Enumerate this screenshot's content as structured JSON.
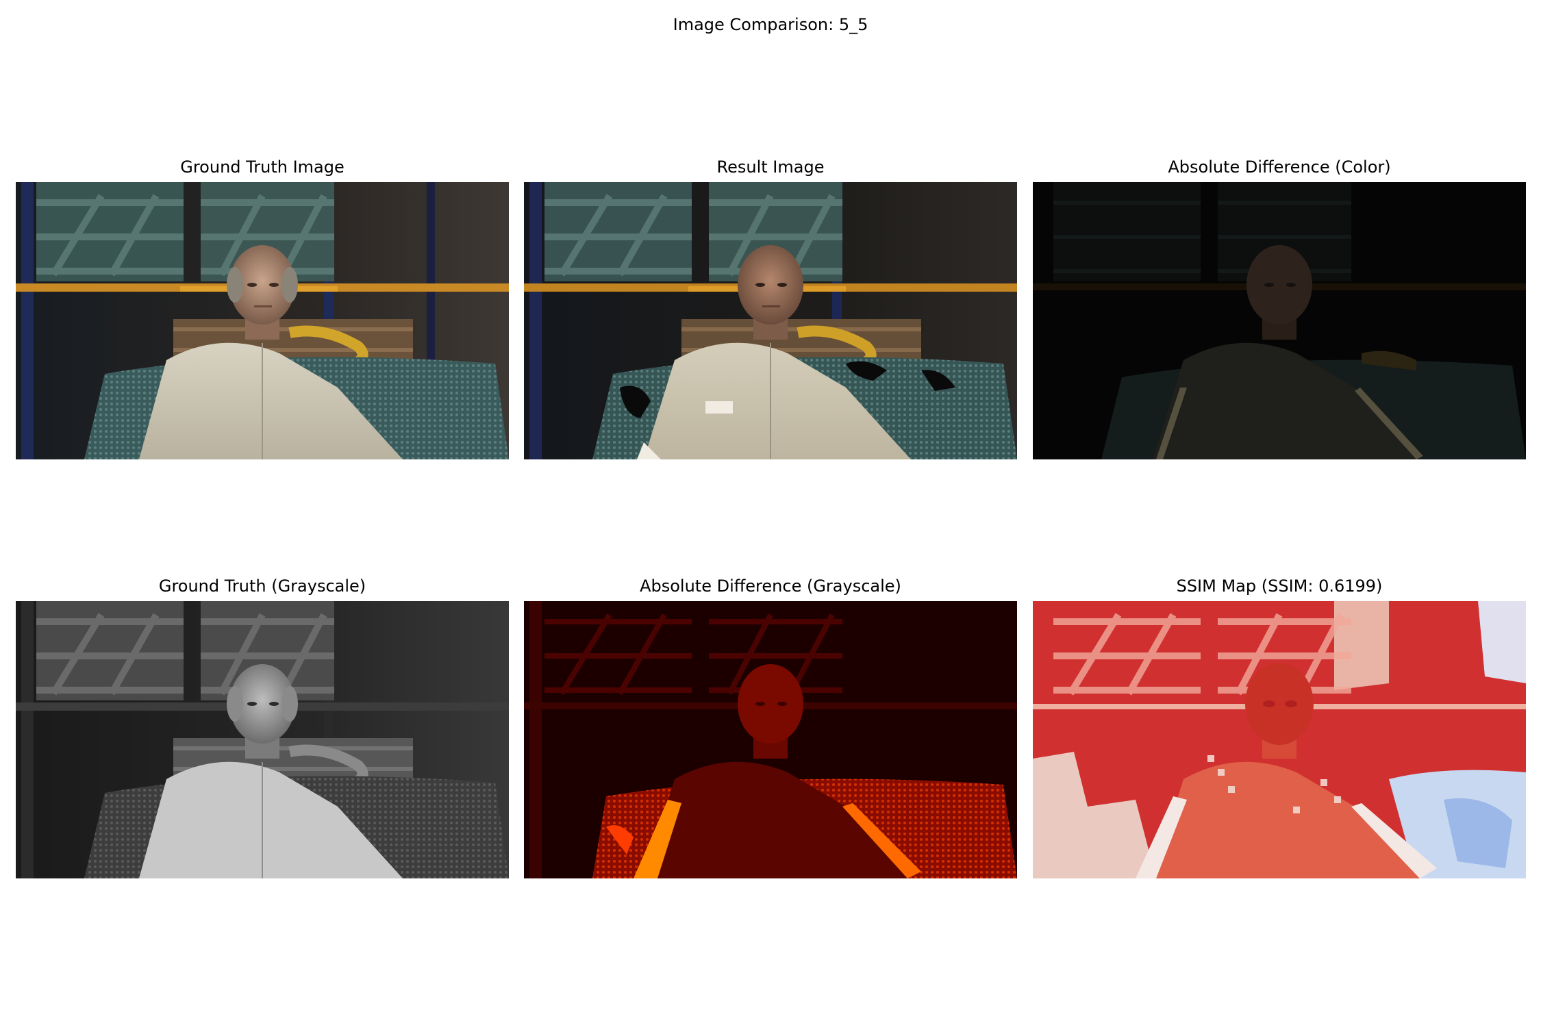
{
  "figure": {
    "title": "Image Comparison: 5_5"
  },
  "panels": [
    {
      "id": "gt",
      "title": "Ground Truth Image"
    },
    {
      "id": "result",
      "title": "Result Image"
    },
    {
      "id": "absdiff_color",
      "title": "Absolute Difference (Color)"
    },
    {
      "id": "gt_gray",
      "title": "Ground Truth (Grayscale)"
    },
    {
      "id": "absdiff_gray",
      "title": "Absolute Difference (Grayscale)"
    },
    {
      "id": "ssim",
      "title": "SSIM Map (SSIM: 0.6199)"
    }
  ]
}
